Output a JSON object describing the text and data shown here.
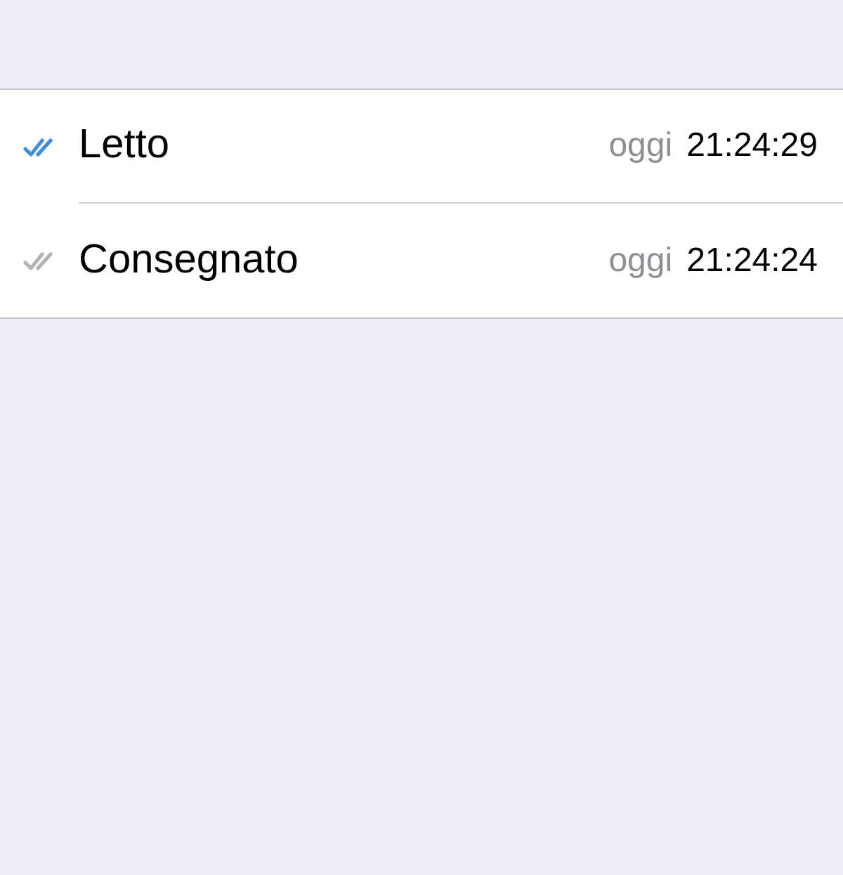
{
  "receipts": [
    {
      "status": "Letto",
      "color": "#3d8ede",
      "day": "oggi",
      "time": "21:24:29"
    },
    {
      "status": "Consegnato",
      "color": "#b4b4b4",
      "day": "oggi",
      "time": "21:24:24"
    }
  ]
}
